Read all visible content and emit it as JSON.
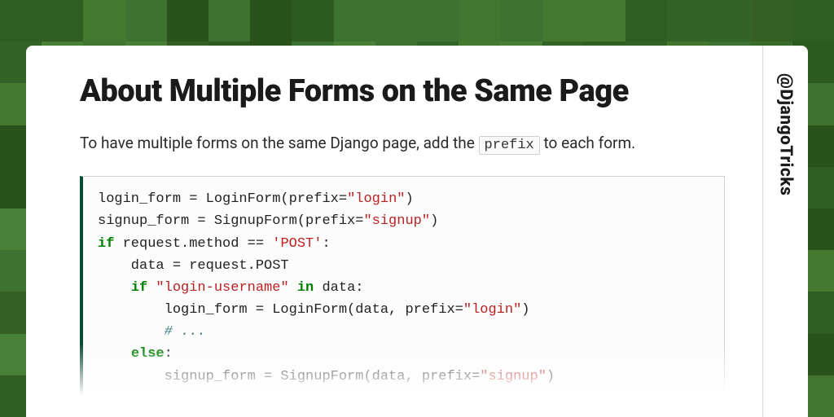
{
  "handle": "@DjangoTricks",
  "title": "About Multiple Forms on the Same Page",
  "intro_pre": "To have multiple forms on the same Django page, add the ",
  "intro_code": "prefix",
  "intro_post": " to each form.",
  "code": {
    "tokens": [
      {
        "t": "login_form = LoginForm(prefix="
      },
      {
        "t": "\"login\"",
        "c": "tok-str"
      },
      {
        "t": ")\n"
      },
      {
        "t": "signup_form = SignupForm(prefix="
      },
      {
        "t": "\"signup\"",
        "c": "tok-str"
      },
      {
        "t": ")\n"
      },
      {
        "t": "if",
        "c": "tok-kw"
      },
      {
        "t": " request.method == "
      },
      {
        "t": "'POST'",
        "c": "tok-str"
      },
      {
        "t": ":\n"
      },
      {
        "t": "    data = request.POST\n"
      },
      {
        "t": "    "
      },
      {
        "t": "if",
        "c": "tok-kw"
      },
      {
        "t": " "
      },
      {
        "t": "\"login-username\"",
        "c": "tok-str"
      },
      {
        "t": " "
      },
      {
        "t": "in",
        "c": "tok-kw"
      },
      {
        "t": " data:\n"
      },
      {
        "t": "        login_form = LoginForm(data, prefix="
      },
      {
        "t": "\"login\"",
        "c": "tok-str"
      },
      {
        "t": ")\n"
      },
      {
        "t": "        "
      },
      {
        "t": "# ...",
        "c": "tok-cm"
      },
      {
        "t": "\n"
      },
      {
        "t": "    "
      },
      {
        "t": "else",
        "c": "tok-kw"
      },
      {
        "t": ":\n"
      },
      {
        "t": "        signup_form = SignupForm(data, prefix="
      },
      {
        "t": "\"signup\"",
        "c": "tok-str"
      },
      {
        "t": ")"
      }
    ]
  },
  "bg_shades": [
    "#2d5a1f",
    "#336326",
    "#3a6b2a",
    "#417530",
    "#488038",
    "#2a531c",
    "#365f24",
    "#3e7230",
    "#305d22",
    "#44792f"
  ]
}
